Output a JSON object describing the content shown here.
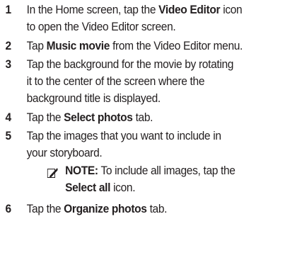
{
  "steps": [
    {
      "number": "1",
      "parts": [
        [
          "In the Home screen, tap the ",
          "Video Editor",
          " icon"
        ],
        [
          "to open the Video Editor screen.",
          "",
          ""
        ]
      ]
    },
    {
      "number": "2",
      "parts": [
        [
          "Tap ",
          "Music movie",
          " from the Video Editor menu."
        ]
      ]
    },
    {
      "number": "3",
      "parts": [
        [
          "Tap the background for the movie by rotating",
          "",
          ""
        ],
        [
          "it to the center of the screen where the",
          "",
          ""
        ],
        [
          "background title is displayed.",
          "",
          ""
        ]
      ]
    },
    {
      "number": "4",
      "parts": [
        [
          "Tap the ",
          "Select photos",
          " tab."
        ]
      ]
    },
    {
      "number": "5",
      "parts": [
        [
          "Tap the images that you want to include in",
          "",
          ""
        ],
        [
          "your storyboard.",
          "",
          ""
        ]
      ]
    },
    {
      "number": "6",
      "parts": [
        [
          "Tap the ",
          "Organize photos",
          " tab."
        ]
      ]
    }
  ],
  "note": {
    "icon": "pencil-note-icon",
    "label": "NOTE:",
    "line1": " To include all images, tap the",
    "line2_bold": "Select all",
    "line2_rest": " icon."
  }
}
